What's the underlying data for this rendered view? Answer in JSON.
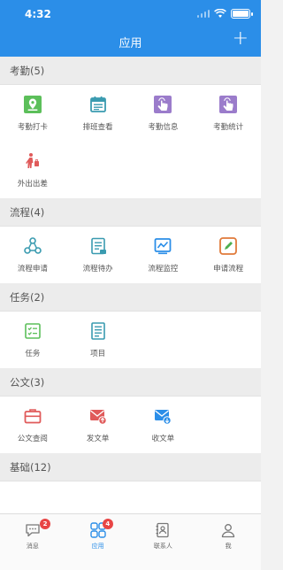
{
  "status_bar": {
    "time": "4:32"
  },
  "nav": {
    "title": "应用",
    "add_symbol": "+"
  },
  "sections": {
    "attendance": {
      "title": "考勤(5)",
      "items": [
        {
          "label": "考勤打卡",
          "icon": "map-pin-icon"
        },
        {
          "label": "排班查看",
          "icon": "calendar-icon"
        },
        {
          "label": "考勤信息",
          "icon": "tap-hand-icon"
        },
        {
          "label": "考勤统计",
          "icon": "tap-hand-icon"
        },
        {
          "label": "外出出差",
          "icon": "traveler-icon"
        }
      ]
    },
    "process": {
      "title": "流程(4)",
      "items": [
        {
          "label": "流程申请",
          "icon": "flow-nodes-icon"
        },
        {
          "label": "流程待办",
          "icon": "todo-list-icon"
        },
        {
          "label": "流程监控",
          "icon": "monitor-chart-icon"
        },
        {
          "label": "申请流程",
          "icon": "pencil-icon"
        }
      ]
    },
    "task": {
      "title": "任务(2)",
      "items": [
        {
          "label": "任务",
          "icon": "checklist-icon"
        },
        {
          "label": "项目",
          "icon": "document-icon"
        }
      ]
    },
    "document": {
      "title": "公文(3)",
      "items": [
        {
          "label": "公文查阅",
          "icon": "briefcase-icon"
        },
        {
          "label": "发文单",
          "icon": "mail-send-icon"
        },
        {
          "label": "收文单",
          "icon": "mail-receive-icon"
        }
      ]
    },
    "basic": {
      "title": "基础(12)"
    }
  },
  "tabbar": {
    "messages": {
      "label": "消息",
      "badge": "2"
    },
    "apps": {
      "label": "应用",
      "badge": "4"
    },
    "contacts": {
      "label": "联系人"
    },
    "me": {
      "label": "我"
    }
  },
  "colors": {
    "brand": "#2b8ee8",
    "green": "#5cbf5a",
    "teal": "#3a9bb0",
    "purple": "#9b7ccb",
    "red": "#e05a5a",
    "blue": "#2b8ee8",
    "orange": "#e07a3a"
  }
}
